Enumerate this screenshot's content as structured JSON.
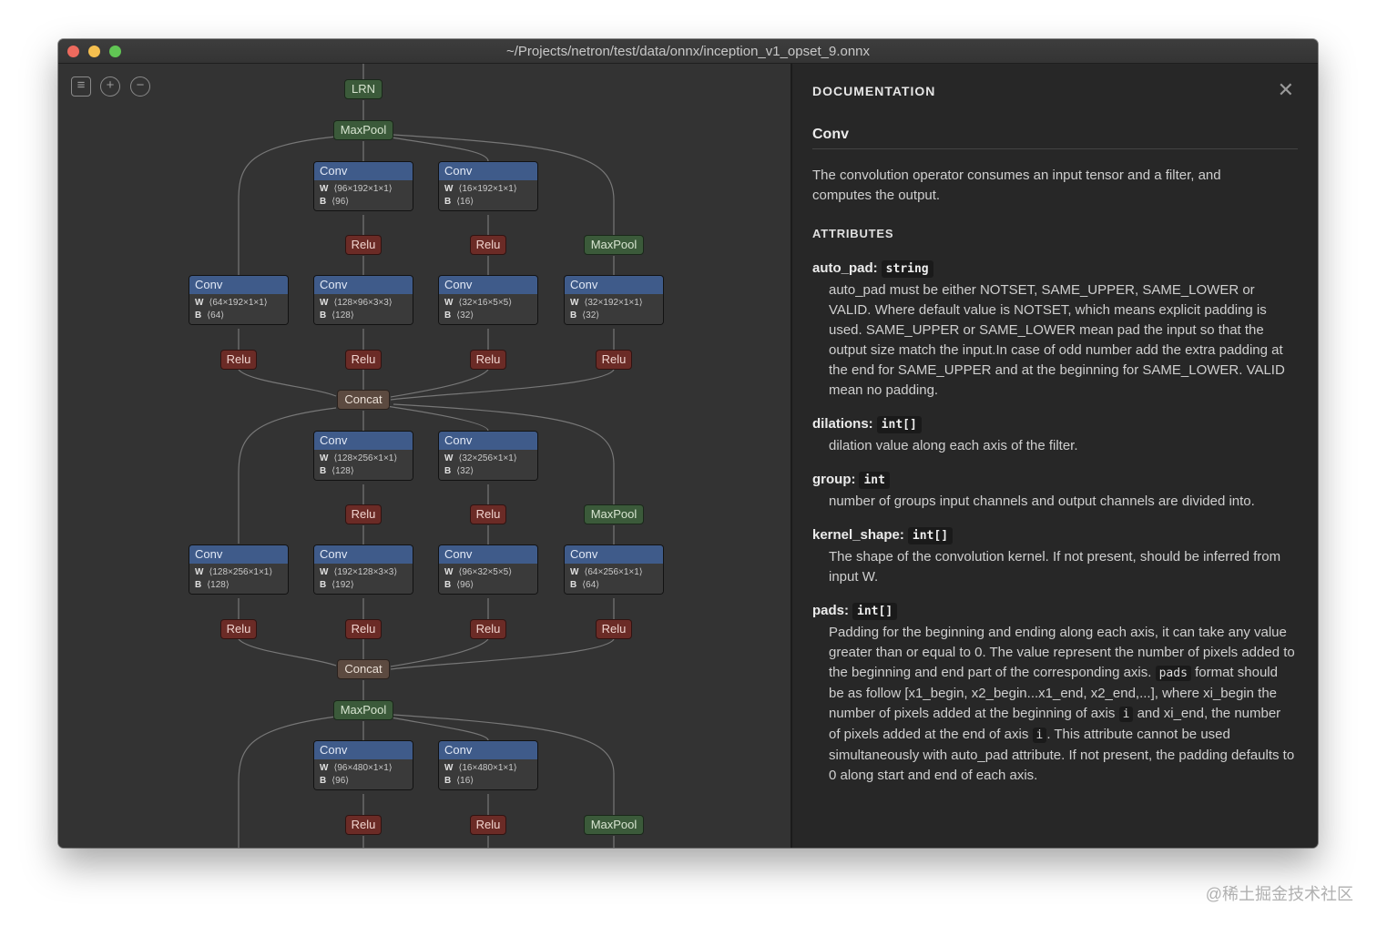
{
  "window": {
    "title": "~/Projects/netron/test/data/onnx/inception_v1_opset_9.onnx"
  },
  "toolbar": {
    "menu_icon": "menu-icon",
    "zoom_in_icon": "zoom-in-icon",
    "zoom_out_icon": "zoom-out-icon"
  },
  "graph": {
    "lrn": "LRN",
    "maxpool": "MaxPool",
    "relu": "Relu",
    "concat": "Concat",
    "conv": "Conv",
    "w": "W",
    "b": "B",
    "convs": [
      {
        "w": "⟨96×192×1×1⟩",
        "b": "⟨96⟩"
      },
      {
        "w": "⟨16×192×1×1⟩",
        "b": "⟨16⟩"
      },
      {
        "w": "⟨64×192×1×1⟩",
        "b": "⟨64⟩"
      },
      {
        "w": "⟨128×96×3×3⟩",
        "b": "⟨128⟩"
      },
      {
        "w": "⟨32×16×5×5⟩",
        "b": "⟨32⟩"
      },
      {
        "w": "⟨32×192×1×1⟩",
        "b": "⟨32⟩"
      },
      {
        "w": "⟨128×256×1×1⟩",
        "b": "⟨128⟩"
      },
      {
        "w": "⟨32×256×1×1⟩",
        "b": "⟨32⟩"
      },
      {
        "w": "⟨128×256×1×1⟩",
        "b": "⟨128⟩"
      },
      {
        "w": "⟨192×128×3×3⟩",
        "b": "⟨192⟩"
      },
      {
        "w": "⟨96×32×5×5⟩",
        "b": "⟨96⟩"
      },
      {
        "w": "⟨64×256×1×1⟩",
        "b": "⟨64⟩"
      },
      {
        "w": "⟨96×480×1×1⟩",
        "b": "⟨96⟩"
      },
      {
        "w": "⟨16×480×1×1⟩",
        "b": "⟨16⟩"
      }
    ]
  },
  "doc": {
    "header": "DOCUMENTATION",
    "close": "✕",
    "op_name": "Conv",
    "description": "The convolution operator consumes an input tensor and a filter, and computes the output.",
    "attributes_header": "ATTRIBUTES",
    "attributes": [
      {
        "name": "auto_pad:",
        "type": "string",
        "desc": "auto_pad must be either NOTSET, SAME_UPPER, SAME_LOWER or VALID. Where default value is NOTSET, which means explicit padding is used. SAME_UPPER or SAME_LOWER mean pad the input so that the output size match the input.In case of odd number add the extra padding at the end for SAME_UPPER and at the beginning for SAME_LOWER. VALID mean no padding."
      },
      {
        "name": "dilations:",
        "type": "int[]",
        "desc": "dilation value along each axis of the filter."
      },
      {
        "name": "group:",
        "type": "int",
        "desc": "number of groups input channels and output channels are divided into."
      },
      {
        "name": "kernel_shape:",
        "type": "int[]",
        "desc": "The shape of the convolution kernel. If not present, should be inferred from input W."
      },
      {
        "name": "pads:",
        "type": "int[]"
      }
    ],
    "pads_desc": {
      "p1": "Padding for the beginning and ending along each axis, it can take any value greater than or equal to 0. The value represent the number of pixels added to the beginning and end part of the corresponding axis.",
      "code1": "pads",
      "p2": "format should be as follow [x1_begin, x2_begin...x1_end, x2_end,...], where xi_begin the number of pixels added at the beginning of axis",
      "code2": "i",
      "p3": "and xi_end, the number of pixels added at the end of axis",
      "code3": "i",
      "p4": ". This attribute cannot be used simultaneously with auto_pad attribute. If not present, the padding defaults to 0 along start and end of each axis."
    }
  },
  "watermark": "@稀土掘金技术社区"
}
